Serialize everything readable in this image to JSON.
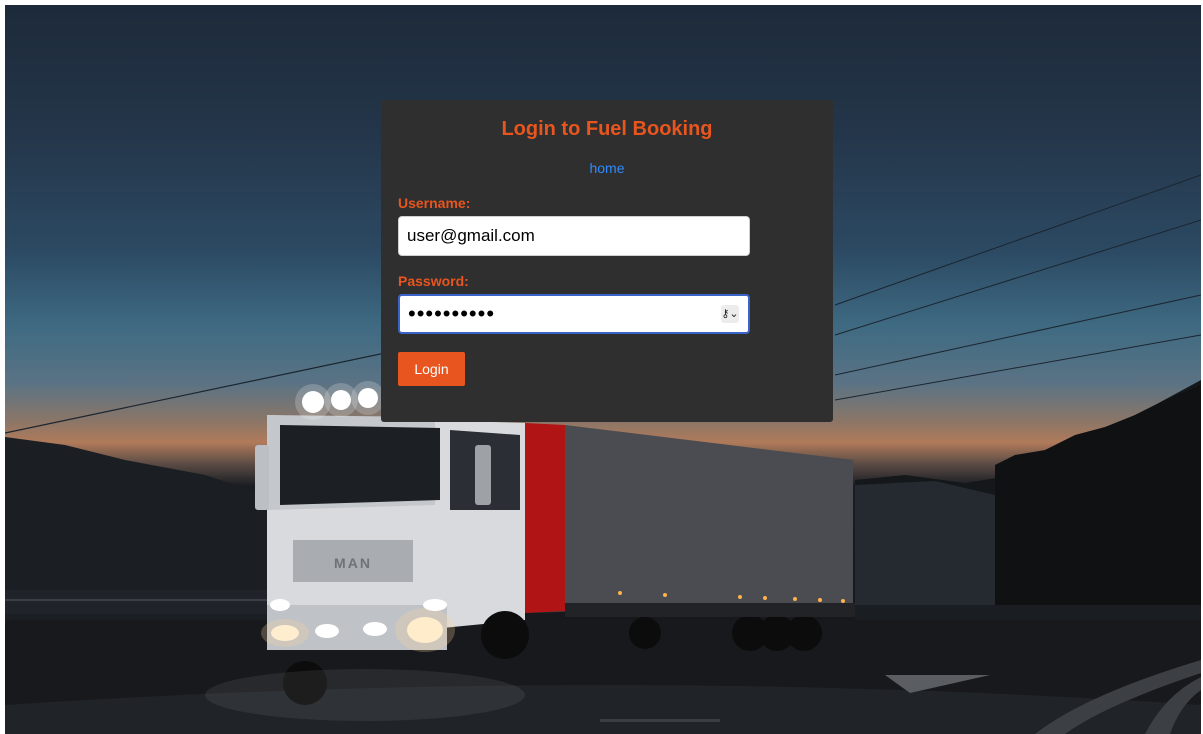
{
  "login": {
    "title": "Login to Fuel Booking",
    "home_link": "home",
    "username_label": "Username:",
    "username_value": "user@gmail.com",
    "password_label": "Password:",
    "password_value": "••••••••••",
    "button_label": "Login"
  },
  "background": {
    "truck_brand": "MAN"
  },
  "colors": {
    "accent": "#e8551e",
    "link": "#2f8bff",
    "card": "#2f2f2f"
  }
}
